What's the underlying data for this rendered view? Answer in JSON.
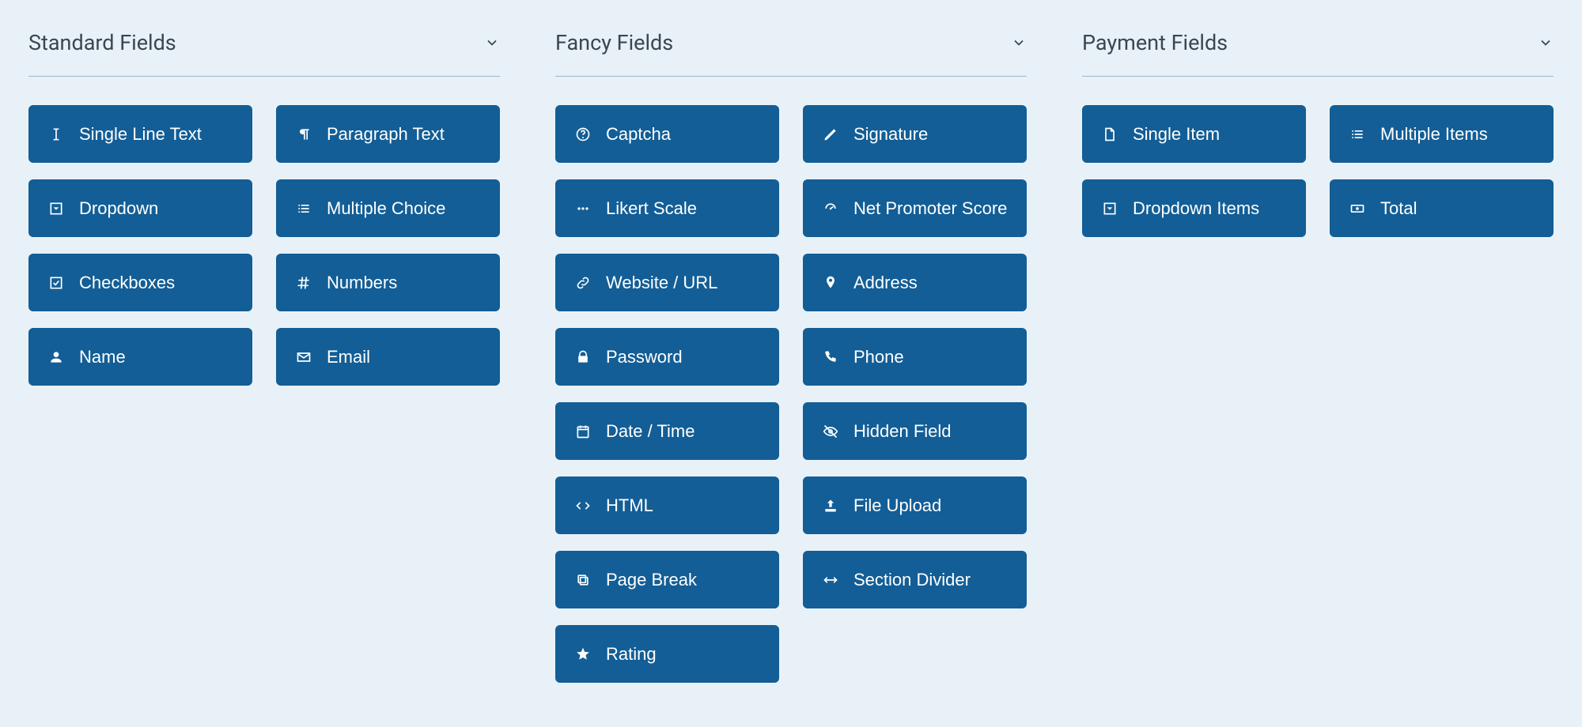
{
  "sections": [
    {
      "title": "Standard Fields",
      "fields": [
        {
          "name": "single-line-text",
          "label": "Single Line Text",
          "icon": "text-cursor"
        },
        {
          "name": "paragraph-text",
          "label": "Paragraph Text",
          "icon": "paragraph"
        },
        {
          "name": "dropdown",
          "label": "Dropdown",
          "icon": "caret-square"
        },
        {
          "name": "multiple-choice",
          "label": "Multiple Choice",
          "icon": "list"
        },
        {
          "name": "checkboxes",
          "label": "Checkboxes",
          "icon": "check-square"
        },
        {
          "name": "numbers",
          "label": "Numbers",
          "icon": "hash"
        },
        {
          "name": "name",
          "label": "Name",
          "icon": "user"
        },
        {
          "name": "email",
          "label": "Email",
          "icon": "envelope"
        }
      ]
    },
    {
      "title": "Fancy Fields",
      "fields": [
        {
          "name": "captcha",
          "label": "Captcha",
          "icon": "question"
        },
        {
          "name": "signature",
          "label": "Signature",
          "icon": "pencil"
        },
        {
          "name": "likert-scale",
          "label": "Likert Scale",
          "icon": "dots"
        },
        {
          "name": "net-promoter",
          "label": "Net Promoter Score",
          "icon": "dashboard"
        },
        {
          "name": "website-url",
          "label": "Website / URL",
          "icon": "link"
        },
        {
          "name": "address",
          "label": "Address",
          "icon": "map-marker"
        },
        {
          "name": "password",
          "label": "Password",
          "icon": "lock"
        },
        {
          "name": "phone",
          "label": "Phone",
          "icon": "phone"
        },
        {
          "name": "date-time",
          "label": "Date / Time",
          "icon": "calendar"
        },
        {
          "name": "hidden-field",
          "label": "Hidden Field",
          "icon": "eye-slash"
        },
        {
          "name": "html",
          "label": "HTML",
          "icon": "code"
        },
        {
          "name": "file-upload",
          "label": "File Upload",
          "icon": "upload"
        },
        {
          "name": "page-break",
          "label": "Page Break",
          "icon": "copy"
        },
        {
          "name": "section-divider",
          "label": "Section Divider",
          "icon": "arrows-h"
        },
        {
          "name": "rating",
          "label": "Rating",
          "icon": "star"
        }
      ]
    },
    {
      "title": "Payment Fields",
      "fields": [
        {
          "name": "single-item",
          "label": "Single Item",
          "icon": "file"
        },
        {
          "name": "multiple-items",
          "label": "Multiple Items",
          "icon": "list"
        },
        {
          "name": "dropdown-items",
          "label": "Dropdown Items",
          "icon": "caret-square"
        },
        {
          "name": "total",
          "label": "Total",
          "icon": "money"
        }
      ]
    }
  ]
}
